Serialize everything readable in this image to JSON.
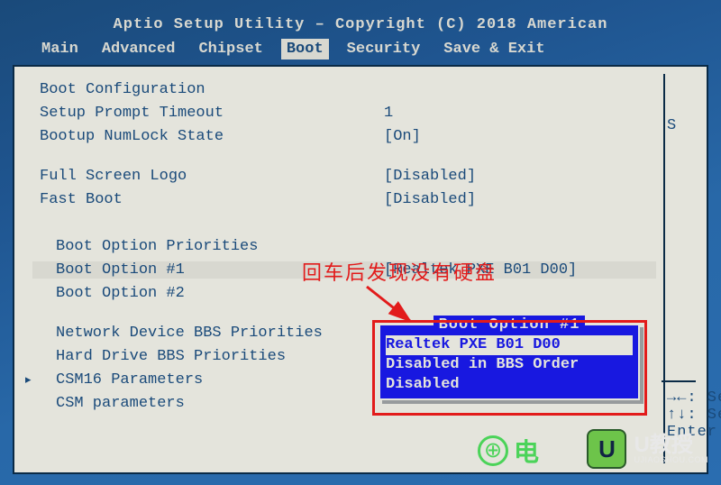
{
  "title": "Aptio Setup Utility – Copyright (C) 2018 American",
  "tabs": [
    "Main",
    "Advanced",
    "Chipset",
    "Boot",
    "Security",
    "Save & Exit"
  ],
  "selected_tab": "Boot",
  "section_header": "Boot Configuration",
  "options": {
    "setup_prompt_timeout": {
      "label": "Setup Prompt Timeout",
      "value": "1"
    },
    "bootup_numlock": {
      "label": "Bootup NumLock State",
      "value": "[On]"
    },
    "full_screen_logo": {
      "label": "Full Screen Logo",
      "value": "[Disabled]"
    },
    "fast_boot": {
      "label": "Fast Boot",
      "value": "[Disabled]"
    }
  },
  "boot_priorities_header": "Boot Option Priorities",
  "boot1": {
    "label": "Boot Option #1",
    "value": "[Realtek PXE B01 D00]"
  },
  "boot2": {
    "label": "Boot Option #2",
    "value": ""
  },
  "submenus": {
    "net_bbs": "Network Device BBS Priorities",
    "hdd_bbs": "Hard Drive BBS Priorities",
    "csm16": "CSM16 Parameters",
    "csm": "CSM parameters"
  },
  "side_help": "S",
  "side_hints": {
    "a": "→←: Selec",
    "b": "↑↓: Selec",
    "c": "Enter: S"
  },
  "popup": {
    "title": "Boot Option #1",
    "items": [
      "Realtek PXE B01 D00",
      "Disabled in BBS Order",
      "Disabled"
    ],
    "selected": "Realtek PXE B01 D00"
  },
  "annotation": "回车后发现没有硬盘",
  "watermark1": "电",
  "watermark2": {
    "icon": "U",
    "name": "U教授",
    "url": "UJIAOSHOU.COM"
  }
}
